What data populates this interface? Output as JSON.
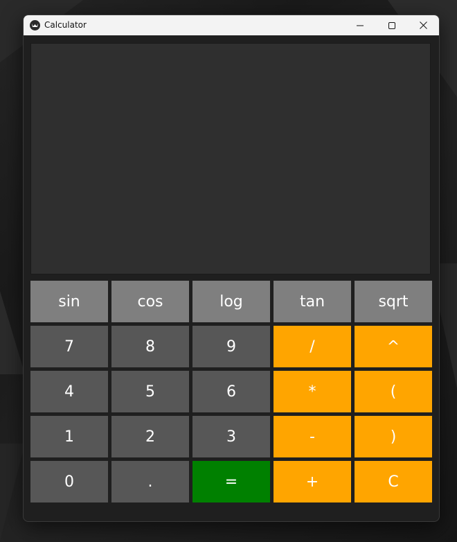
{
  "window": {
    "title": "Calculator",
    "controls": {
      "minimize": "minimize-icon",
      "maximize": "maximize-icon",
      "close": "close-icon"
    }
  },
  "display": {
    "value": ""
  },
  "colors": {
    "function_key": "#7f7f7f",
    "number_key": "#575757",
    "operator_key": "#ffa500",
    "equals_key": "#008000",
    "display_bg": "#2f2f2f",
    "window_bg": "#1f1f1f"
  },
  "keypad": {
    "row1": [
      "sin",
      "cos",
      "log",
      "tan",
      "sqrt"
    ],
    "row2": [
      "7",
      "8",
      "9",
      "/",
      "^"
    ],
    "row3": [
      "4",
      "5",
      "6",
      "*",
      "("
    ],
    "row4": [
      "1",
      "2",
      "3",
      "-",
      ")"
    ],
    "row5": [
      "0",
      ".",
      "=",
      "+",
      "C"
    ]
  }
}
